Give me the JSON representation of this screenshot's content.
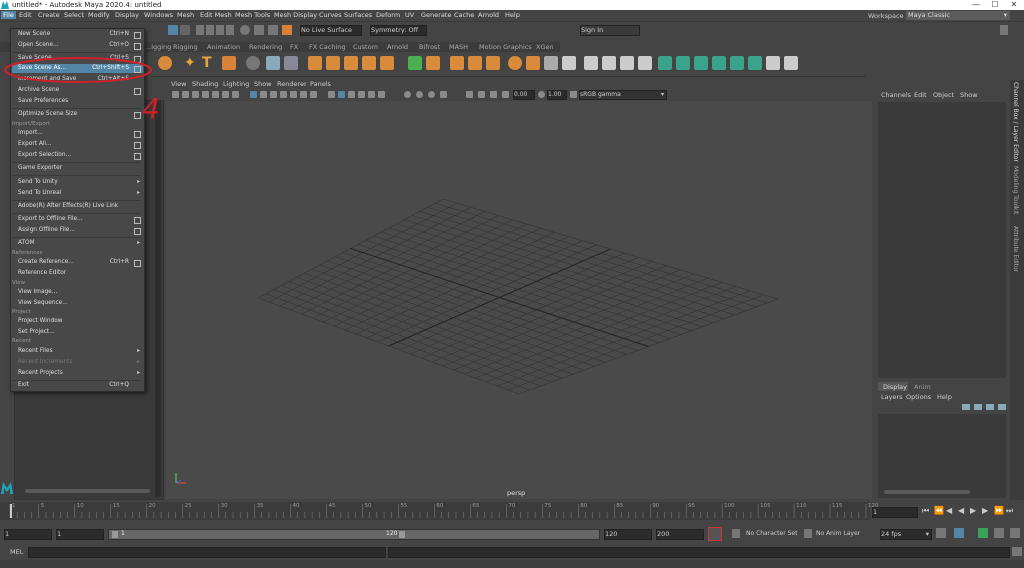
{
  "window": {
    "title": "untitled* - Autodesk Maya 2020.4: untitled",
    "minimize": "—",
    "maximize": "☐",
    "close": "✕"
  },
  "menubar": [
    "File",
    "Edit",
    "Create",
    "Select",
    "Modify",
    "Display",
    "Windows",
    "Mesh",
    "Edit Mesh",
    "Mesh Tools",
    "Mesh Display",
    "Curves",
    "Surfaces",
    "Deform",
    "UV",
    "Generate",
    "Cache",
    "Arnold",
    "Help"
  ],
  "workspace": {
    "label": "Workspace :",
    "value": "Maya Classic"
  },
  "status_line": {
    "live_surface": "No Live Surface",
    "symmetry": "Symmetry: Off",
    "sign_in": "Sign In"
  },
  "shelf_tabs": [
    "...igging",
    "Rigging",
    "Animation",
    "Rendering",
    "FX",
    "FX Caching",
    "Custom",
    "Arnold",
    "Bifrost",
    "MASH",
    "Motion Graphics",
    "XGen"
  ],
  "panel_menu": [
    "View",
    "Shading",
    "Lighting",
    "Show",
    "Renderer",
    "Panels"
  ],
  "panel_toolbar": {
    "exposure": "0.00",
    "gamma": "1.00",
    "color_space": "sRGB gamma"
  },
  "viewport": {
    "camera_label": "persp"
  },
  "channel_box": {
    "menus": [
      "Channels",
      "Edit",
      "Object",
      "Show"
    ]
  },
  "layer_editor": {
    "tabs": [
      "Display",
      "Anim"
    ],
    "menus": [
      "Layers",
      "Options",
      "Help"
    ]
  },
  "side_tabs": [
    "Channel Box / Layer Editor",
    "Modeling Toolkit",
    "Attribute Editor"
  ],
  "file_menu": {
    "items": [
      {
        "label": "New Scene",
        "shortcut": "Ctrl+N",
        "option": true
      },
      {
        "label": "Open Scene...",
        "shortcut": "Ctrl+O",
        "option": true
      },
      {
        "label": "Save Scene",
        "shortcut": "Ctrl+S",
        "option": true
      },
      {
        "label": "Save Scene As...",
        "shortcut": "Ctrl+Shift+S",
        "option": true,
        "highlighted": true
      },
      {
        "label": "Increment and Save",
        "shortcut": "Ctrl+Alt+S",
        "option": false
      },
      {
        "label": "Archive Scene",
        "shortcut": "",
        "option": true
      },
      {
        "label": "Save Preferences",
        "shortcut": "",
        "option": false
      },
      {
        "label": "Optimize Scene Size",
        "shortcut": "",
        "option": true
      },
      {
        "section": "Import/Export"
      },
      {
        "label": "Import...",
        "shortcut": "",
        "option": true
      },
      {
        "label": "Export All...",
        "shortcut": "",
        "option": true
      },
      {
        "label": "Export Selection...",
        "shortcut": "",
        "option": true
      },
      {
        "label": "Game Exporter",
        "shortcut": "",
        "option": false
      },
      {
        "label": "Send To Unity",
        "submenu": true
      },
      {
        "label": "Send To Unreal",
        "submenu": true
      },
      {
        "label": "Adobe(R) After Effects(R) Live Link",
        "shortcut": "",
        "option": false
      },
      {
        "label": "Export to Offline File...",
        "shortcut": "",
        "option": true
      },
      {
        "label": "Assign Offline File...",
        "shortcut": "",
        "option": true
      },
      {
        "label": "ATOM",
        "submenu": true
      },
      {
        "section": "References"
      },
      {
        "label": "Create Reference...",
        "shortcut": "Ctrl+R",
        "option": true
      },
      {
        "label": "Reference Editor",
        "shortcut": "",
        "option": false
      },
      {
        "section": "View"
      },
      {
        "label": "View Image...",
        "shortcut": "",
        "option": false
      },
      {
        "label": "View Sequence...",
        "shortcut": "",
        "option": false
      },
      {
        "section": "Project"
      },
      {
        "label": "Project Window",
        "shortcut": "",
        "option": false
      },
      {
        "label": "Set Project...",
        "shortcut": "",
        "option": false
      },
      {
        "section": "Recent"
      },
      {
        "label": "Recent Files",
        "submenu": true
      },
      {
        "label": "Recent Increments",
        "submenu": true,
        "disabled": true
      },
      {
        "label": "Recent Projects",
        "submenu": true
      },
      {
        "label": "Exit",
        "shortcut": "Ctrl+Q",
        "option": false
      }
    ]
  },
  "annotation": {
    "mark": "4"
  },
  "time_slider": {
    "ticks": [
      "1",
      "5",
      "10",
      "15",
      "20",
      "25",
      "30",
      "35",
      "40",
      "45",
      "50",
      "55",
      "60",
      "65",
      "70",
      "75",
      "80",
      "85",
      "90",
      "95",
      "100",
      "105",
      "110",
      "115",
      "120"
    ],
    "current_frame": "1"
  },
  "range_slider": {
    "start": "1",
    "playback_start": "1",
    "range_start_label": "1",
    "range_end_label": "120",
    "playback_end": "120",
    "end": "200",
    "character_set": "No Character Set",
    "anim_layer": "No Anim Layer",
    "fps": "24 fps"
  },
  "command_line": {
    "label": "MEL"
  }
}
